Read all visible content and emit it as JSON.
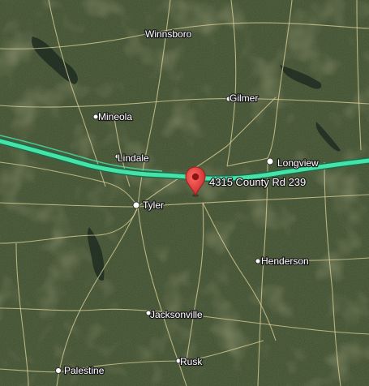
{
  "map": {
    "view": "satellite",
    "route_color": "#46e3a6",
    "pin_color": "#e53935",
    "places": {
      "winnsboro": "Winnsboro",
      "gilmer": "Gilmer",
      "mineola": "Mineola",
      "lindale": "Lindale",
      "longview": "Longview",
      "tyler": "Tyler",
      "henderson": "Henderson",
      "jacksonville": "Jacksonville",
      "rusk": "Rusk",
      "palestine": "Palestine"
    },
    "pin": {
      "icon": "map-pin-icon",
      "label": "4315 County Rd 239"
    }
  }
}
